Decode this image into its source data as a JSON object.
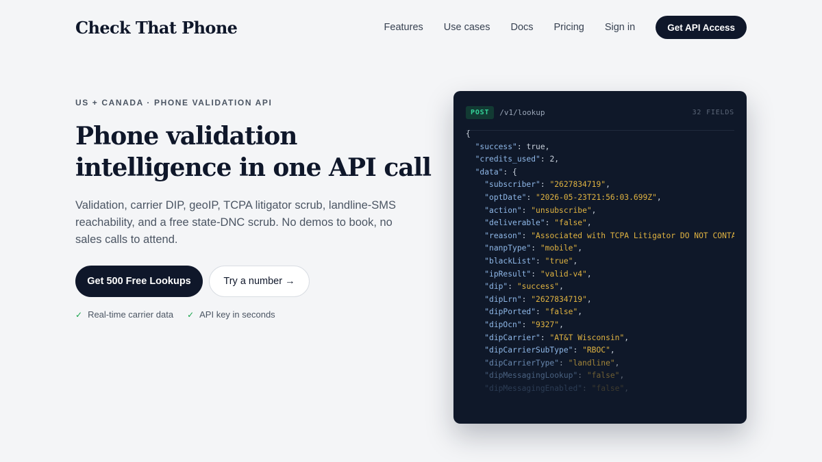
{
  "header": {
    "logo": "Check That Phone",
    "nav": [
      "Features",
      "Use cases",
      "Docs",
      "Pricing",
      "Sign in"
    ],
    "cta": "Get API Access"
  },
  "hero": {
    "eyebrow": "US + CANADA · PHONE VALIDATION API",
    "headline_line1": "Phone validation",
    "headline_line2": "intelligence in one API call",
    "subtext": "Validation, carrier DIP, geoIP, TCPA litigator scrub, landline-SMS reachability, and a free state-DNC scrub. No demos to book, no sales calls to attend.",
    "primary_button": "Get 500 Free Lookups",
    "secondary_button": "Try a number →",
    "checks": [
      {
        "icon": "check-icon",
        "label": "Real-time carrier data"
      },
      {
        "icon": "check-icon",
        "label": "API key in seconds"
      }
    ]
  },
  "code_panel": {
    "method": "POST",
    "endpoint": "/v1/lookup",
    "fields_count": "32 FIELDS",
    "lines": [
      {
        "indent": 0,
        "open": "{"
      },
      {
        "indent": 1,
        "key": "\"success\"",
        "value": "true",
        "type": "literal"
      },
      {
        "indent": 1,
        "key": "\"credits_used\"",
        "value": "2",
        "type": "literal"
      },
      {
        "indent": 1,
        "key": "\"data\"",
        "value": "{",
        "type": "open"
      },
      {
        "indent": 2,
        "key": "\"subscriber\"",
        "value": "\"2627834719\"",
        "type": "string"
      },
      {
        "indent": 2,
        "key": "\"optDate\"",
        "value": "\"2026-05-23T21:56:03.699Z\"",
        "type": "string"
      },
      {
        "indent": 2,
        "key": "\"action\"",
        "value": "\"unsubscribe\"",
        "type": "string"
      },
      {
        "indent": 2,
        "key": "\"deliverable\"",
        "value": "\"false\"",
        "type": "string"
      },
      {
        "indent": 2,
        "key": "\"reason\"",
        "value": "\"Associated with TCPA Litigator DO NOT CONTA",
        "type": "string"
      },
      {
        "indent": 2,
        "key": "\"nanpType\"",
        "value": "\"mobile\"",
        "type": "string"
      },
      {
        "indent": 2,
        "key": "\"blackList\"",
        "value": "\"true\"",
        "type": "string"
      },
      {
        "indent": 2,
        "key": "\"ipResult\"",
        "value": "\"valid-v4\"",
        "type": "string"
      },
      {
        "indent": 2,
        "key": "\"dip\"",
        "value": "\"success\"",
        "type": "string"
      },
      {
        "indent": 2,
        "key": "\"dipLrn\"",
        "value": "\"2627834719\"",
        "type": "string"
      },
      {
        "indent": 2,
        "key": "\"dipPorted\"",
        "value": "\"false\"",
        "type": "string"
      },
      {
        "indent": 2,
        "key": "\"dipOcn\"",
        "value": "\"9327\"",
        "type": "string"
      },
      {
        "indent": 2,
        "key": "\"dipCarrier\"",
        "value": "\"AT&T Wisconsin\"",
        "type": "string"
      },
      {
        "indent": 2,
        "key": "\"dipCarrierSubType\"",
        "value": "\"RBOC\"",
        "type": "string"
      },
      {
        "indent": 2,
        "key": "\"dipCarrierType\"",
        "value": "\"landline\"",
        "type": "string",
        "fade": 1
      },
      {
        "indent": 2,
        "key": "\"dipMessagingLookup\"",
        "value": "\"false\"",
        "type": "string",
        "fade": 2
      },
      {
        "indent": 2,
        "key": "\"dipMessagingEnabled\"",
        "value": "\"false\"",
        "type": "string",
        "fade": 3
      }
    ]
  }
}
